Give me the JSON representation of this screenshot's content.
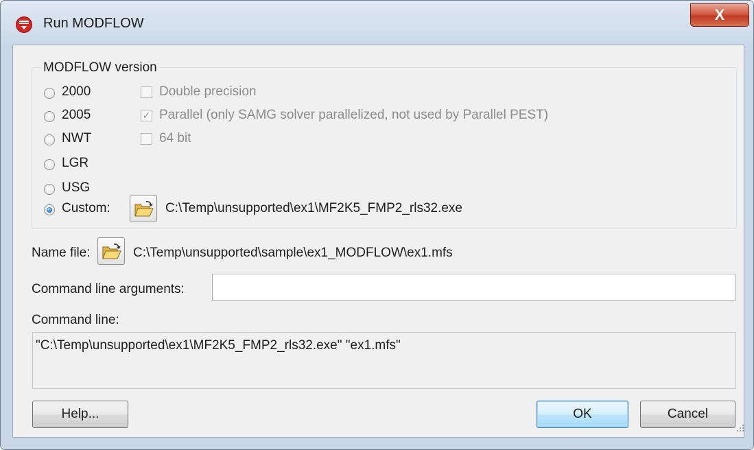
{
  "window": {
    "title": "Run MODFLOW",
    "close_label": "X"
  },
  "modflow_version": {
    "legend": "MODFLOW version",
    "options": [
      {
        "label": "2000",
        "checked": false
      },
      {
        "label": "2005",
        "checked": false
      },
      {
        "label": "NWT",
        "checked": false
      },
      {
        "label": "LGR",
        "checked": false
      },
      {
        "label": "USG",
        "checked": false
      },
      {
        "label": "Custom:",
        "checked": true
      }
    ],
    "checkboxes": [
      {
        "label": "Double precision",
        "checked": false,
        "enabled": false
      },
      {
        "label": "Parallel (only SAMG solver parallelized, not used by Parallel PEST)",
        "checked": true,
        "enabled": false
      },
      {
        "label": "64 bit",
        "checked": false,
        "enabled": false
      }
    ],
    "custom_path": "C:\\Temp\\unsupported\\ex1\\MF2K5_FMP2_rls32.exe"
  },
  "name_file": {
    "label": "Name file:",
    "path": "C:\\Temp\\unsupported\\sample\\ex1_MODFLOW\\ex1.mfs"
  },
  "command_line_arguments": {
    "label": "Command line arguments:",
    "value": ""
  },
  "command_line": {
    "label": "Command line:",
    "value": "\"C:\\Temp\\unsupported\\ex1\\MF2K5_FMP2_rls32.exe\" \"ex1.mfs\""
  },
  "buttons": {
    "help": "Help...",
    "ok": "OK",
    "cancel": "Cancel"
  },
  "colors": {
    "title_bar": "#d3dfec",
    "close_button": "#c03a22",
    "dialog_bg": "#f0f0f0",
    "default_button": "#bee6fd"
  }
}
